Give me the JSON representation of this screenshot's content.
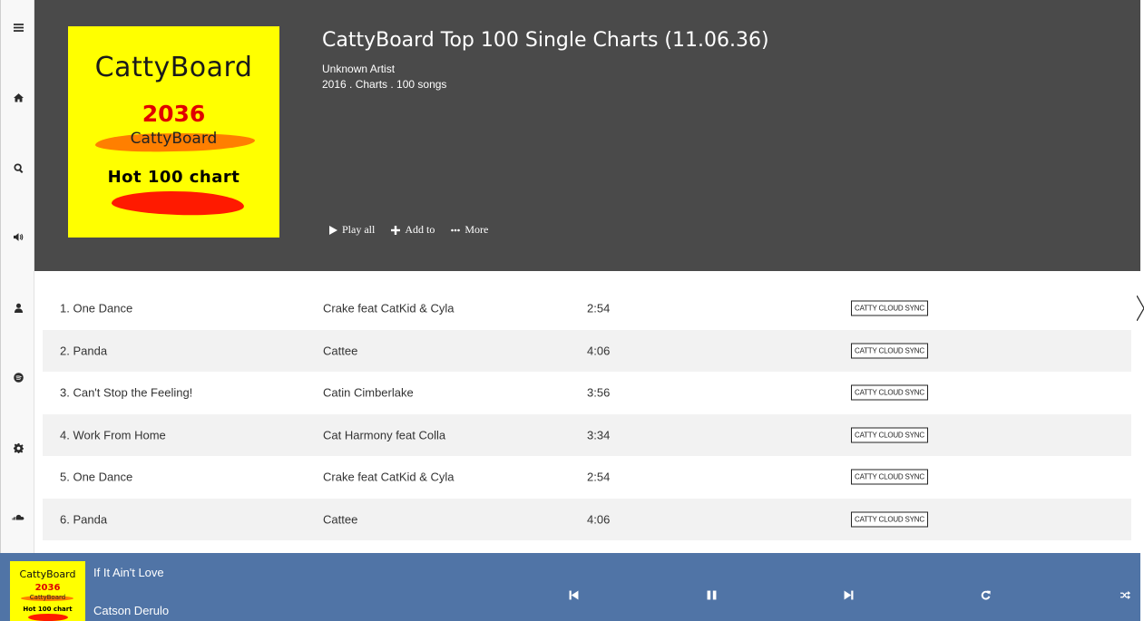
{
  "sidebar": {
    "items": [
      {
        "icon": "menu-icon"
      },
      {
        "icon": "home-icon"
      },
      {
        "icon": "search-icon"
      },
      {
        "icon": "volume-icon"
      },
      {
        "icon": "user-icon"
      },
      {
        "icon": "spotify-icon"
      },
      {
        "icon": "gear-icon"
      },
      {
        "icon": "soundcloud-icon"
      }
    ]
  },
  "album": {
    "cover": {
      "title": "CattyBoard",
      "year": "2036",
      "subtitle": "CattyBoard",
      "chart": "Hot 100 chart"
    },
    "title": "CattyBoard Top 100 Single Charts (11.06.36)",
    "artist": "Unknown Artist",
    "meta": "2016 . Charts . 100 songs",
    "actions": {
      "play_all": "Play all",
      "add_to": "Add to",
      "more": "More"
    }
  },
  "tracks": [
    {
      "name": "1. One Dance",
      "artist": "Crake feat CatKid & Cyla",
      "duration": "2:54",
      "badge": "CATTY CLOUD SYNC"
    },
    {
      "name": "2. Panda",
      "artist": "Cattee",
      "duration": "4:06",
      "badge": "CATTY CLOUD SYNC"
    },
    {
      "name": "3. Can't Stop the Feeling!",
      "artist": "Catin Cimberlake",
      "duration": "3:56",
      "badge": "CATTY CLOUD SYNC"
    },
    {
      "name": "4. Work From Home",
      "artist": "Cat Harmony feat Colla",
      "duration": "3:34",
      "badge": "CATTY CLOUD SYNC"
    },
    {
      "name": "5. One Dance",
      "artist": "Crake feat CatKid & Cyla",
      "duration": "2:54",
      "badge": "CATTY CLOUD SYNC"
    },
    {
      "name": "6. Panda",
      "artist": "Cattee",
      "duration": "4:06",
      "badge": "CATTY CLOUD SYNC"
    }
  ],
  "player": {
    "cover": {
      "title": "CattyBoard",
      "year": "2036",
      "subtitle": "CattyBoard",
      "chart": "Hot 100 chart"
    },
    "song": "If It Ain't Love",
    "artist": "Catson Derulo",
    "controls": [
      "previous-icon",
      "pause-icon",
      "next-icon",
      "repeat-icon",
      "shuffle-icon"
    ]
  },
  "colors": {
    "header_bg": "#4a4a4a",
    "player_bg": "#5074a6",
    "cover_bg": "#ffff00",
    "row_alt": "#f2f2f2"
  }
}
